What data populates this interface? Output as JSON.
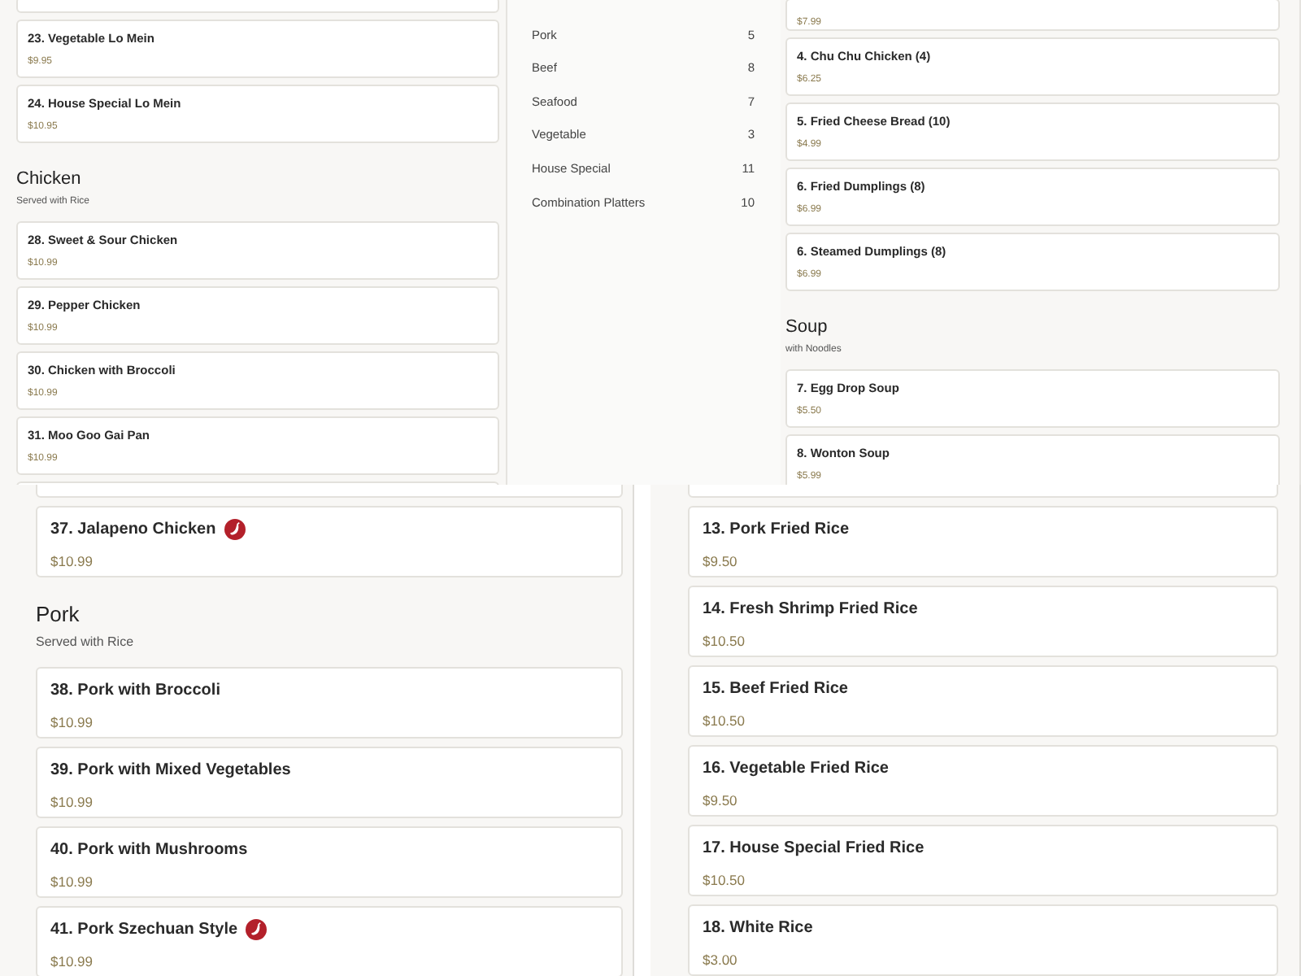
{
  "top_view": {
    "left_column": [
      {
        "kind": "stub"
      },
      {
        "kind": "item",
        "name": "23. Vegetable Lo Mein",
        "price": "$9.95",
        "spicy": false
      },
      {
        "kind": "item",
        "name": "24. House Special Lo Mein",
        "price": "$10.95",
        "spicy": false
      },
      {
        "kind": "section",
        "title": "Chicken",
        "subtitle": "Served with Rice"
      },
      {
        "kind": "item",
        "name": "28. Sweet & Sour Chicken",
        "price": "$10.99",
        "spicy": false
      },
      {
        "kind": "item",
        "name": "29. Pepper Chicken",
        "price": "$10.99",
        "spicy": false
      },
      {
        "kind": "item",
        "name": "30. Chicken with Broccoli",
        "price": "$10.99",
        "spicy": false
      },
      {
        "kind": "item",
        "name": "31. Moo Goo Gai Pan",
        "price": "$10.99",
        "spicy": false
      },
      {
        "kind": "stub"
      }
    ],
    "categories": [
      {
        "name": "Pork",
        "count": "5"
      },
      {
        "name": "Beef",
        "count": "8"
      },
      {
        "name": "Seafood",
        "count": "7"
      },
      {
        "name": "Vegetable",
        "count": "3"
      },
      {
        "name": "House Special",
        "count": "11"
      },
      {
        "name": "Combination Platters",
        "count": "10"
      }
    ],
    "right_column": [
      {
        "kind": "item",
        "price": "$7.99"
      },
      {
        "kind": "item",
        "name": "4. Chu Chu Chicken (4)",
        "price": "$6.25",
        "spicy": false
      },
      {
        "kind": "item",
        "name": "5. Fried Cheese Bread (10)",
        "price": "$4.99",
        "spicy": false
      },
      {
        "kind": "item",
        "name": "6. Fried Dumplings (8)",
        "price": "$6.99",
        "spicy": false
      },
      {
        "kind": "item",
        "name": "6. Steamed Dumplings (8)",
        "price": "$6.99",
        "spicy": false
      },
      {
        "kind": "section",
        "title": "Soup",
        "subtitle": "with Noodles"
      },
      {
        "kind": "item",
        "name": "7. Egg Drop Soup",
        "price": "$5.50",
        "spicy": false
      },
      {
        "kind": "item",
        "name": "8. Wonton Soup",
        "price": "$5.99",
        "spicy": false
      }
    ]
  },
  "bottom_view": {
    "left_column": [
      {
        "kind": "stub"
      },
      {
        "kind": "item",
        "name": "37. Jalapeno Chicken",
        "price": "$10.99",
        "spicy": true
      },
      {
        "kind": "section",
        "title": "Pork",
        "subtitle": "Served with Rice"
      },
      {
        "kind": "item",
        "name": "38. Pork with Broccoli",
        "price": "$10.99",
        "spicy": false
      },
      {
        "kind": "item",
        "name": "39. Pork with Mixed Vegetables",
        "price": "$10.99",
        "spicy": false
      },
      {
        "kind": "item",
        "name": "40. Pork with Mushrooms",
        "price": "$10.99",
        "spicy": false
      },
      {
        "kind": "item",
        "name": "41. Pork Szechuan Style",
        "price": "$10.99",
        "spicy": true
      }
    ],
    "right_column": [
      {
        "kind": "stub"
      },
      {
        "kind": "item",
        "name": "13. Pork Fried Rice",
        "price": "$9.50",
        "spicy": false
      },
      {
        "kind": "item",
        "name": "14. Fresh Shrimp Fried Rice",
        "price": "$10.50",
        "spicy": false
      },
      {
        "kind": "item",
        "name": "15. Beef Fried Rice",
        "price": "$10.50",
        "spicy": false
      },
      {
        "kind": "item",
        "name": "16. Vegetable Fried Rice",
        "price": "$9.50",
        "spicy": false
      },
      {
        "kind": "item",
        "name": "17. House Special Fried Rice",
        "price": "$10.50",
        "spicy": false
      },
      {
        "kind": "item",
        "name": "18. White Rice",
        "price": "$3.00",
        "spicy": false
      }
    ]
  }
}
